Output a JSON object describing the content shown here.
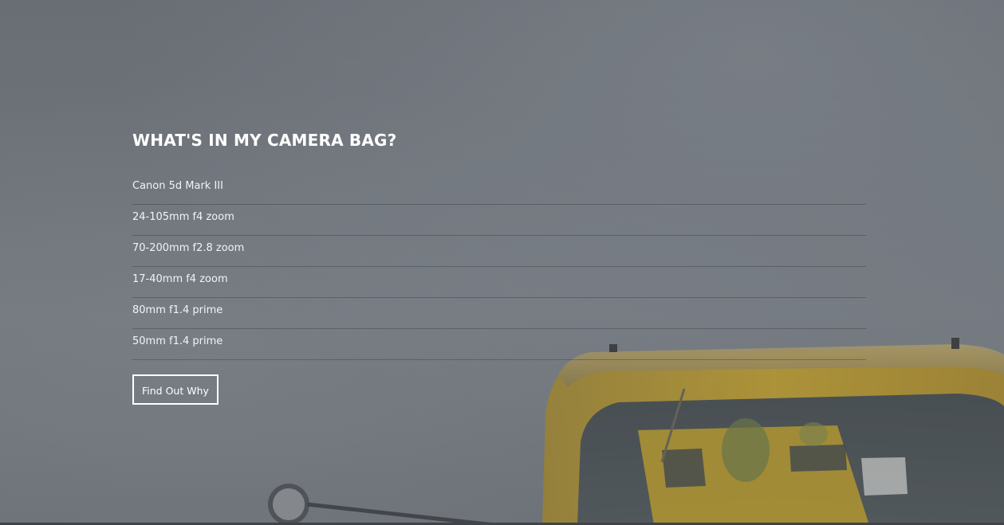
{
  "section": {
    "heading": "WHAT'S IN MY CAMERA BAG?",
    "items": [
      {
        "label": "Canon 5d Mark III"
      },
      {
        "label": "24-105mm f4 zoom"
      },
      {
        "label": "70-200mm f2.8 zoom"
      },
      {
        "label": "17-40mm f4 zoom"
      },
      {
        "label": "80mm f1.4 prime"
      },
      {
        "label": "50mm f1.4 prime"
      }
    ],
    "button_label": "Find Out Why"
  },
  "background": {
    "subject": "vintage-yellow-truck-photo",
    "overlay_color": "#6f747b",
    "truck_color": "#c9a21c"
  }
}
